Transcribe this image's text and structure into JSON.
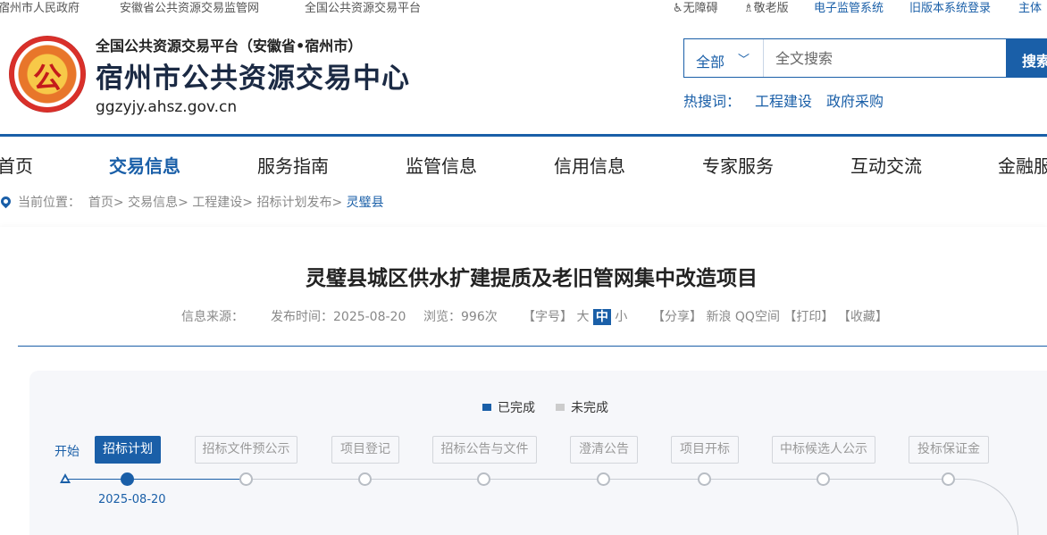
{
  "topbar": {
    "left_links": [
      "宿州市人民政府",
      "安徽省公共资源交易监管网",
      "全国公共资源交易平台"
    ],
    "accessibility": "无障碍",
    "elder": "敬老版",
    "links_blue": [
      "电子监管系统",
      "旧版本系统登录",
      "主体"
    ]
  },
  "header": {
    "logo_glyph": "公",
    "subtitle": "全国公共资源交易平台（安徽省•宿州市）",
    "title": "宿州市公共资源交易中心",
    "domain": "ggzyjy.ahsz.gov.cn"
  },
  "search": {
    "scope": "全部",
    "placeholder": "全文搜索",
    "button": "搜索",
    "hot_label": "热搜词：",
    "hot_words": [
      "工程建设",
      "政府采购"
    ]
  },
  "nav": [
    "首页",
    "交易信息",
    "服务指南",
    "监管信息",
    "信用信息",
    "专家服务",
    "互动交流",
    "金融服务"
  ],
  "nav_active": "交易信息",
  "breadcrumb": {
    "label": "当前位置：",
    "path": "首页> 交易信息> 工程建设> 招标计划发布>",
    "current": "灵璧县"
  },
  "article": {
    "title": "灵璧县城区供水扩建提质及老旧管网集中改造项目",
    "source_label": "信息来源：",
    "publish": "发布时间：2025-08-20",
    "views": "浏览：996次",
    "font_label": "【字号】",
    "font_sizes": [
      "大",
      "中",
      "小"
    ],
    "share_label": "【分享】",
    "share_targets": [
      "新浪",
      "QQ空间"
    ],
    "print": "【打印】",
    "favorite": "【收藏】"
  },
  "process": {
    "legend_done": "已完成",
    "legend_todo": "未完成",
    "start": "开始",
    "steps": [
      {
        "label": "招标计划",
        "done": true
      },
      {
        "label": "招标文件预公示",
        "done": false
      },
      {
        "label": "项目登记",
        "done": false
      },
      {
        "label": "招标公告与文件",
        "done": false
      },
      {
        "label": "澄清公告",
        "done": false
      },
      {
        "label": "项目开标",
        "done": false
      },
      {
        "label": "中标候选人公示",
        "done": false
      },
      {
        "label": "投标保证金",
        "done": false
      }
    ],
    "date": "2025-08-20"
  },
  "colors": {
    "primary": "#1a5fa8",
    "todo": "#cccccc"
  }
}
